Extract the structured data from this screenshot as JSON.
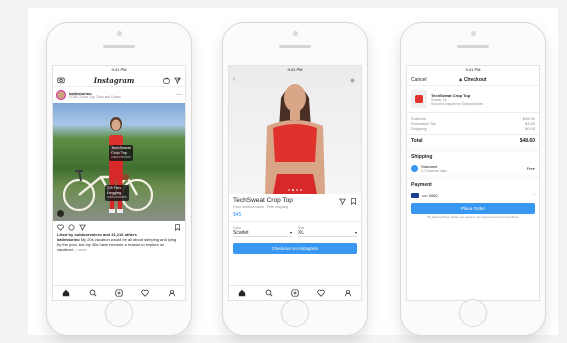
{
  "colors": {
    "accent": "#3897f0",
    "red": "#e0312d",
    "tag_bg": "#1a1a1a"
  },
  "phone1": {
    "status_time": "9:41 PM",
    "logo": "Instagram",
    "icons": [
      "camera-icon",
      "igtv-icon",
      "send-icon"
    ],
    "username": "katiesturino",
    "location": "COMO Tierra Cay, Turks and Caicos",
    "tags": [
      {
        "title": "TechSweat",
        "title2": "Crop Top",
        "sub": "outdoorvoices"
      },
      {
        "title": "7/8 Flex",
        "title2": "Legging",
        "sub": "outdoorvoices"
      }
    ],
    "liked_by": "Liked by outdoorvoices and 31,216 others",
    "caption_user": "katiesturino",
    "caption_text": "My 20s vacation would be all about sleeping and lying by the pool, but my 30s have become a reason to explore on vacation!...",
    "caption_more": "more"
  },
  "phone2": {
    "status_time": "9:41 PM",
    "product_name": "TechSweat Crop Top",
    "product_sub": "From outdoorvoices · Free shipping",
    "price": "$45",
    "color_label": "Color",
    "color_value": "Scarlet",
    "size_label": "Size",
    "size_value": "XL",
    "checkout_button": "Checkout on Instagram"
  },
  "phone3": {
    "status_time": "9:41 PM",
    "cancel": "Cancel",
    "title": "Checkout",
    "item_name": "TechSweat Crop Top",
    "item_variant": "Scarlet, XL",
    "item_seller": "Sold and shipped by Outdoorvoices",
    "summary": [
      {
        "label": "Subtotal",
        "value": "$45.00"
      },
      {
        "label": "Estimated Tax",
        "value": "$3.60"
      },
      {
        "label": "Shipping",
        "value": "$0.00"
      }
    ],
    "total_label": "Total",
    "total_value": "$48.60",
    "shipping_header": "Shipping",
    "shipping_option": "Standard",
    "shipping_detail": "3-7 business days",
    "shipping_price": "Free",
    "payment_header": "Payment",
    "card_mask": "•••• 0000",
    "place_order": "Place Order",
    "terms": "By tapping Place Order you agree to our payment terms and policies"
  }
}
